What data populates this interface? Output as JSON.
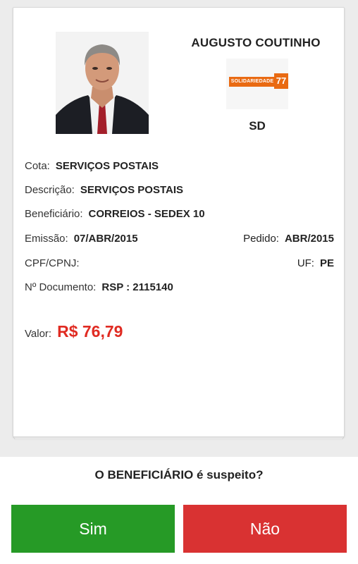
{
  "deputy": {
    "name": "AUGUSTO COUTINHO",
    "party_logo_text": "SOLIDARIEDADE",
    "party_logo_number": "77",
    "party_abbrev": "SD"
  },
  "expense": {
    "cota_label": "Cota:",
    "cota_value": "SERVIÇOS POSTAIS",
    "descricao_label": "Descrição:",
    "descricao_value": "SERVIÇOS POSTAIS",
    "beneficiario_label": "Beneficiário:",
    "beneficiario_value": "CORREIOS - SEDEX 10",
    "emissao_label": "Emissão:",
    "emissao_value": "07/ABR/2015",
    "pedido_label": "Pedido:",
    "pedido_value": "ABR/2015",
    "cpf_label": "CPF/CPNJ:",
    "cpf_value": "",
    "uf_label": "UF:",
    "uf_value": "PE",
    "documento_label": "Nº Documento:",
    "documento_value": "RSP : 2115140",
    "valor_label": "Valor:",
    "valor_value": "R$ 76,79"
  },
  "question": "O BENEFICIÁRIO é suspeito?",
  "buttons": {
    "yes_label": "Sim",
    "no_label": "Não"
  },
  "colors": {
    "accent_red": "#e02b22",
    "yes_green": "#269a26",
    "no_red": "#d93232",
    "party_orange": "#e96a12"
  }
}
